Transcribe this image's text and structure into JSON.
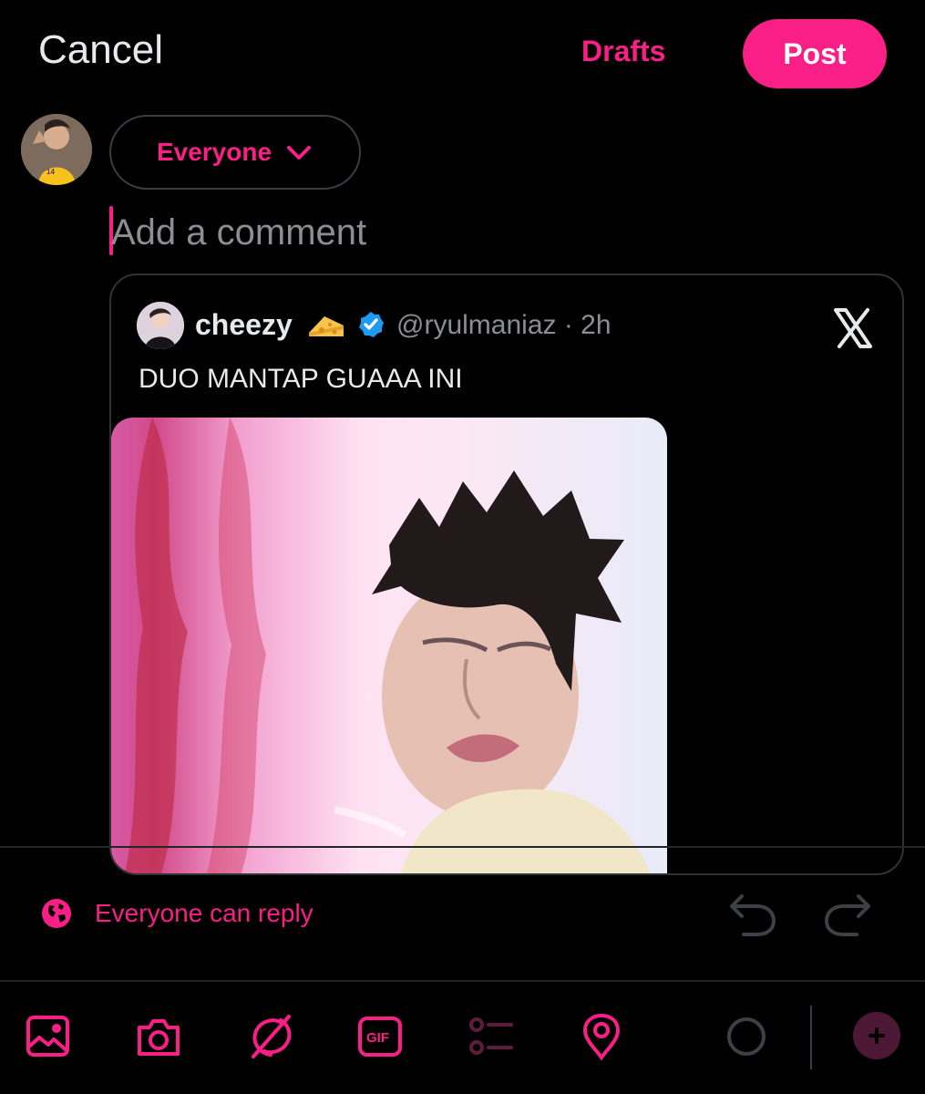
{
  "header": {
    "cancel_label": "Cancel",
    "drafts_label": "Drafts",
    "post_label": "Post"
  },
  "audience": {
    "label": "Everyone"
  },
  "composer": {
    "placeholder": "Add a comment"
  },
  "quote": {
    "name": "cheezy",
    "emoji": "🧀",
    "handle": "@ryulmaniaz · 2h",
    "text": "DUO MANTAP GUAAA INI",
    "verified": true
  },
  "reply": {
    "label": "Everyone can reply"
  },
  "toolbar": {
    "icons": [
      "image-icon",
      "camera-icon",
      "grok-icon",
      "gif-icon",
      "poll-icon",
      "location-icon",
      "progress-ring-icon",
      "plus-icon"
    ]
  },
  "colors": {
    "accent": "#f91f87",
    "background": "#000000",
    "text": "#e7e9ea",
    "muted": "#8b8f94"
  }
}
